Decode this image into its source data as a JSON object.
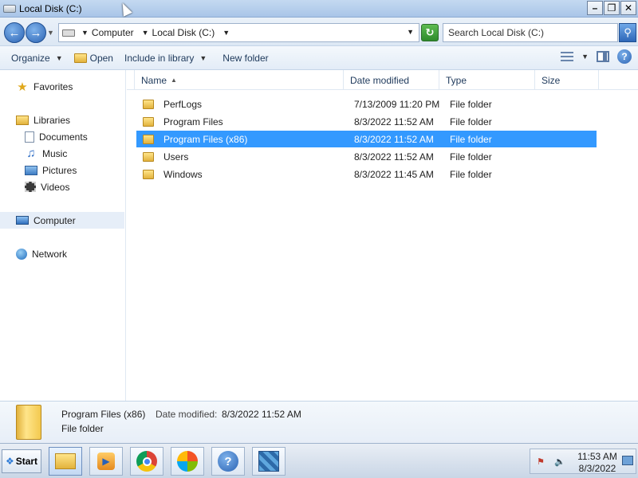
{
  "window": {
    "title": "Local Disk (C:)"
  },
  "address": {
    "crumbs": [
      "Computer",
      "Local Disk (C:)"
    ]
  },
  "search": {
    "placeholder": "Search Local Disk (C:)"
  },
  "toolbar": {
    "organize": "Organize",
    "open": "Open",
    "include_in_library": "Include in library",
    "new_folder": "New folder"
  },
  "nav": {
    "favorites": "Favorites",
    "libraries": "Libraries",
    "documents": "Documents",
    "music": "Music",
    "pictures": "Pictures",
    "videos": "Videos",
    "computer": "Computer",
    "network": "Network"
  },
  "columns": {
    "name": "Name",
    "date_modified": "Date modified",
    "type": "Type",
    "size": "Size"
  },
  "files": [
    {
      "name": "PerfLogs",
      "date": "7/13/2009 11:20 PM",
      "type": "File folder"
    },
    {
      "name": "Program Files",
      "date": "8/3/2022 11:52 AM",
      "type": "File folder"
    },
    {
      "name": "Program Files (x86)",
      "date": "8/3/2022 11:52 AM",
      "type": "File folder",
      "selected": true
    },
    {
      "name": "Users",
      "date": "8/3/2022 11:52 AM",
      "type": "File folder"
    },
    {
      "name": "Windows",
      "date": "8/3/2022 11:45 AM",
      "type": "File folder"
    }
  ],
  "details": {
    "name": "Program Files (x86)",
    "date_label": "Date modified:",
    "date": "8/3/2022 11:52 AM",
    "type": "File folder"
  },
  "taskbar": {
    "start": "Start",
    "time": "11:53 AM",
    "date": "8/3/2022"
  },
  "colors": {
    "selection": "#3399ff",
    "accent": "#2b63b3"
  }
}
